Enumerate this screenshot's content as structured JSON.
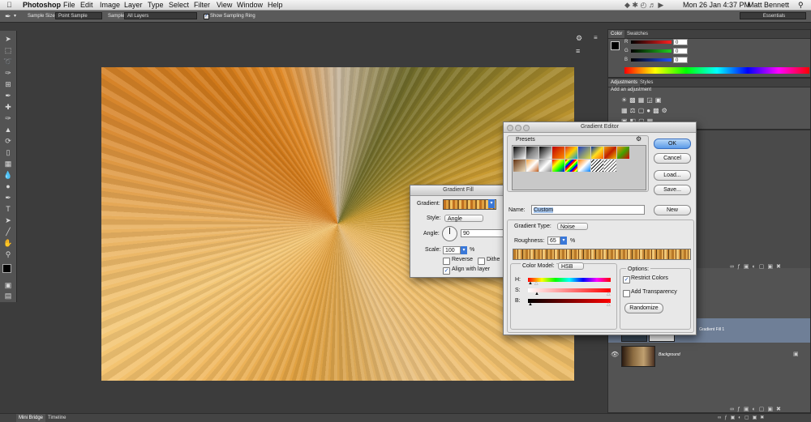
{
  "menubar": {
    "app_name": "Photoshop",
    "menus": [
      "File",
      "Edit",
      "Image",
      "Layer",
      "Type",
      "Select",
      "Filter",
      "View",
      "Window",
      "Help"
    ],
    "clock": "Mon 26 Jan  4:37 PM",
    "user": "Matt Bennett"
  },
  "options_bar": {
    "sample_size_label": "Sample Size:",
    "sample_size_value": "Point Sample",
    "sample_label": "Sample:",
    "sample_value": "All Layers",
    "show_ring_label": "Show Sampling Ring",
    "workspace": "Essentials"
  },
  "color_panel": {
    "tabs": [
      "Color",
      "Swatches"
    ],
    "channels": [
      {
        "label": "R",
        "value": "0",
        "color": "#e03030"
      },
      {
        "label": "G",
        "value": "0",
        "color": "#30b030"
      },
      {
        "label": "B",
        "value": "0",
        "color": "#3060e0"
      }
    ]
  },
  "adjustments_panel": {
    "tabs": [
      "Adjustments",
      "Styles"
    ],
    "heading": "Add an adjustment"
  },
  "layers_panel": {
    "layers": [
      {
        "name": "Gradient Fill 1",
        "selected": true,
        "visible": false
      },
      {
        "name": "Background",
        "selected": false,
        "visible": true
      }
    ]
  },
  "gradient_fill": {
    "title": "Gradient Fill",
    "gradient_label": "Gradient:",
    "style_label": "Style:",
    "style_value": "Angle",
    "angle_label": "Angle:",
    "angle_value": "90",
    "scale_label": "Scale:",
    "scale_value": "100",
    "percent": "%",
    "reverse_label": "Reverse",
    "dither_label": "Dithe",
    "align_label": "Align with layer",
    "reverse_checked": false,
    "dither_checked": false,
    "align_checked": true
  },
  "gradient_editor": {
    "title": "Gradient Editor",
    "presets_label": "Presets",
    "ok_label": "OK",
    "cancel_label": "Cancel",
    "load_label": "Load...",
    "save_label": "Save...",
    "name_label": "Name:",
    "name_value": "Custom",
    "new_label": "New",
    "gradient_type_label": "Gradient Type:",
    "gradient_type_value": "Noise",
    "roughness_label": "Roughness:",
    "roughness_value": "65",
    "percent": "%",
    "color_model_label": "Color Model:",
    "color_model_value": "HSB",
    "channel_h": "H:",
    "channel_s": "S:",
    "channel_b": "B:",
    "options_label": "Options:",
    "restrict_colors_label": "Restrict Colors",
    "add_transparency_label": "Add Transparency",
    "restrict_checked": true,
    "transparency_checked": false,
    "randomize_label": "Randomize"
  },
  "bottom_tabs": [
    "Mini Bridge",
    "Timeline"
  ]
}
